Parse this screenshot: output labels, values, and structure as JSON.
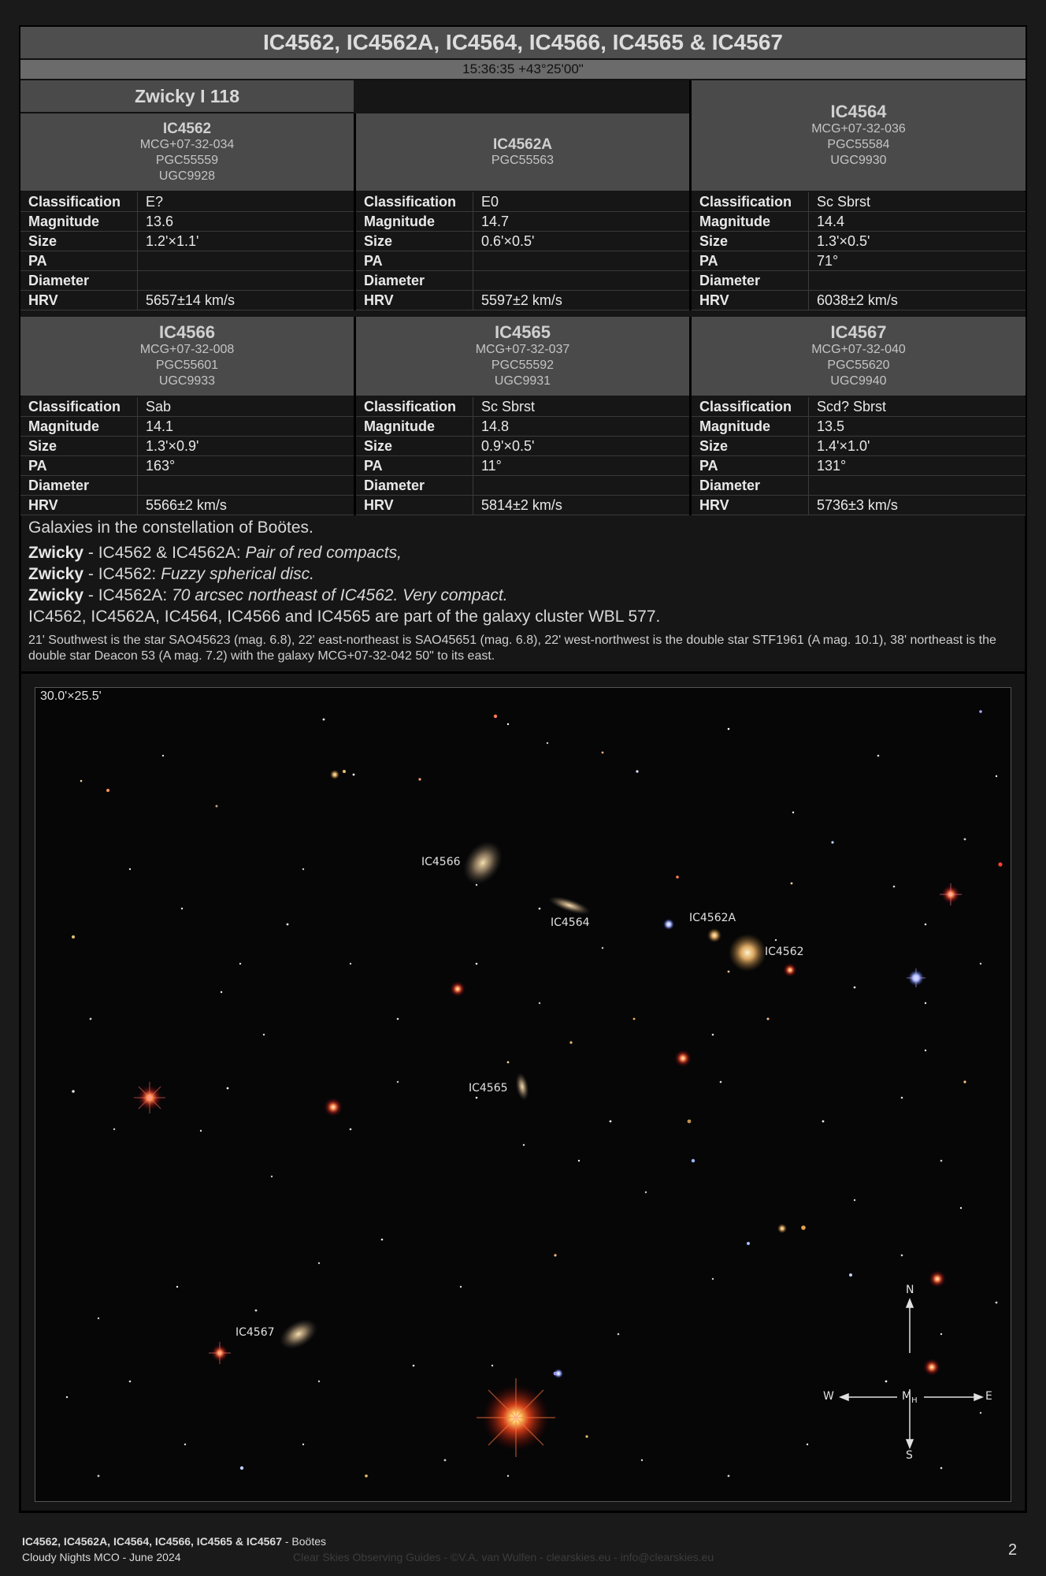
{
  "title": "IC4562, IC4562A, IC4564, IC4566, IC4565 & IC4567",
  "coordinates": "15:36:35 +43°25'00\"",
  "group_title": "Zwicky I 118",
  "prop_labels": [
    "Classification",
    "Magnitude",
    "Size",
    "PA",
    "Diameter",
    "HRV"
  ],
  "galaxies": [
    {
      "name": "IC4562",
      "catalogs": [
        "MCG+07-32-034",
        "PGC55559",
        "UGC9928"
      ],
      "props": [
        "E?",
        "13.6",
        "1.2'×1.1'",
        "",
        "",
        "5657±14 km/s"
      ]
    },
    {
      "name": "IC4562A",
      "catalogs": [
        "PGC55563"
      ],
      "props": [
        "E0",
        "14.7",
        "0.6'×0.5'",
        "",
        "",
        "5597±2 km/s"
      ]
    },
    {
      "name": "IC4564",
      "catalogs": [
        "MCG+07-32-036",
        "PGC55584",
        "UGC9930"
      ],
      "props": [
        "Sc Sbrst",
        "14.4",
        "1.3'×0.5'",
        "71°",
        "",
        "6038±2 km/s"
      ]
    },
    {
      "name": "IC4566",
      "catalogs": [
        "MCG+07-32-008",
        "PGC55601",
        "UGC9933"
      ],
      "props": [
        "Sab",
        "14.1",
        "1.3'×0.9'",
        "163°",
        "",
        "5566±2 km/s"
      ]
    },
    {
      "name": "IC4565",
      "catalogs": [
        "MCG+07-32-037",
        "PGC55592",
        "UGC9931"
      ],
      "props": [
        "Sc Sbrst",
        "14.8",
        "0.9'×0.5'",
        "11°",
        "",
        "5814±2 km/s"
      ]
    },
    {
      "name": "IC4567",
      "catalogs": [
        "MCG+07-32-040",
        "PGC55620",
        "UGC9940"
      ],
      "props": [
        "Scd? Sbrst",
        "13.5",
        "1.4'×1.0'",
        "131°",
        "",
        "5736±3 km/s"
      ]
    }
  ],
  "description": {
    "constellation": "Galaxies in the constellation of Boötes.",
    "zwicky": [
      {
        "label": "Zwicky",
        "subject": " - IC4562 & IC4562A: ",
        "note": "Pair of red compacts,"
      },
      {
        "label": "Zwicky",
        "subject": " - IC4562: ",
        "note": "Fuzzy spherical disc."
      },
      {
        "label": "Zwicky",
        "subject": " - IC4562A: ",
        "note": "70 arcsec northeast of IC4562. Very compact."
      }
    ],
    "cluster": "IC4562, IC4562A, IC4564, IC4566 and IC4565 are part of the galaxy cluster WBL 577.",
    "stars": "21' Southwest is the star SAO45623 (mag. 6.8), 22' east-northeast is SAO45651 (mag. 6.8), 22' west-northwest is the double star STF1961 (A mag. 10.1), 38' northeast is the double star Deacon 53 (A mag. 7.2) with the galaxy MCG+07-32-042 50\" to its east."
  },
  "image": {
    "fov": "30.0'×25.5'",
    "labels": {
      "ic4566": "IC4566",
      "ic4564": "IC4564",
      "ic4562a": "IC4562A",
      "ic4562": "IC4562",
      "ic4565": "IC4565",
      "ic4567": "IC4567"
    },
    "compass": {
      "n": "N",
      "s": "S",
      "e": "E",
      "w": "W",
      "center": "M",
      "center_sub": "H"
    }
  },
  "footer": {
    "objects": "IC4562, IC4562A, IC4564, IC4566, IC4565 & IC4567",
    "constellation": " - Boötes",
    "event": "Cloudy Nights MCO - June 2024",
    "credit": "Clear Skies Observing Guides - ©V.A. van Wulfen - clearskies.eu - info@clearskies.eu",
    "page": "2"
  }
}
